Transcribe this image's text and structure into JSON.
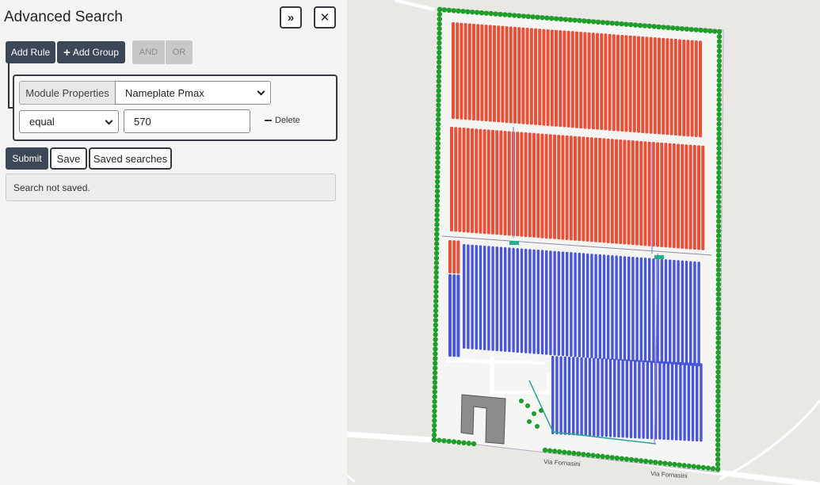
{
  "panel": {
    "title": "Advanced Search",
    "expand_icon": "»",
    "close_icon": "✕"
  },
  "toolbar": {
    "add_rule": "Add Rule",
    "add_group_plus": "+",
    "add_group": "Add Group",
    "and_label": "AND",
    "or_label": "OR"
  },
  "rule": {
    "field_group": "Module Properties",
    "field": "Nameplate Pmax",
    "operator": "equal",
    "value": "570",
    "delete_label": "Delete"
  },
  "actions": {
    "submit": "Submit",
    "save": "Save",
    "saved_searches": "Saved searches"
  },
  "status_message": "Search not saved.",
  "map": {
    "street_label_1": "Via Fornasini",
    "street_label_2": "Via Fornasini",
    "colors": {
      "selected_module": "#e8503a",
      "module": "#4a56d8",
      "hedge": "#1f9e2a",
      "road": "#ffffff",
      "building": "#8c8c8c"
    }
  }
}
